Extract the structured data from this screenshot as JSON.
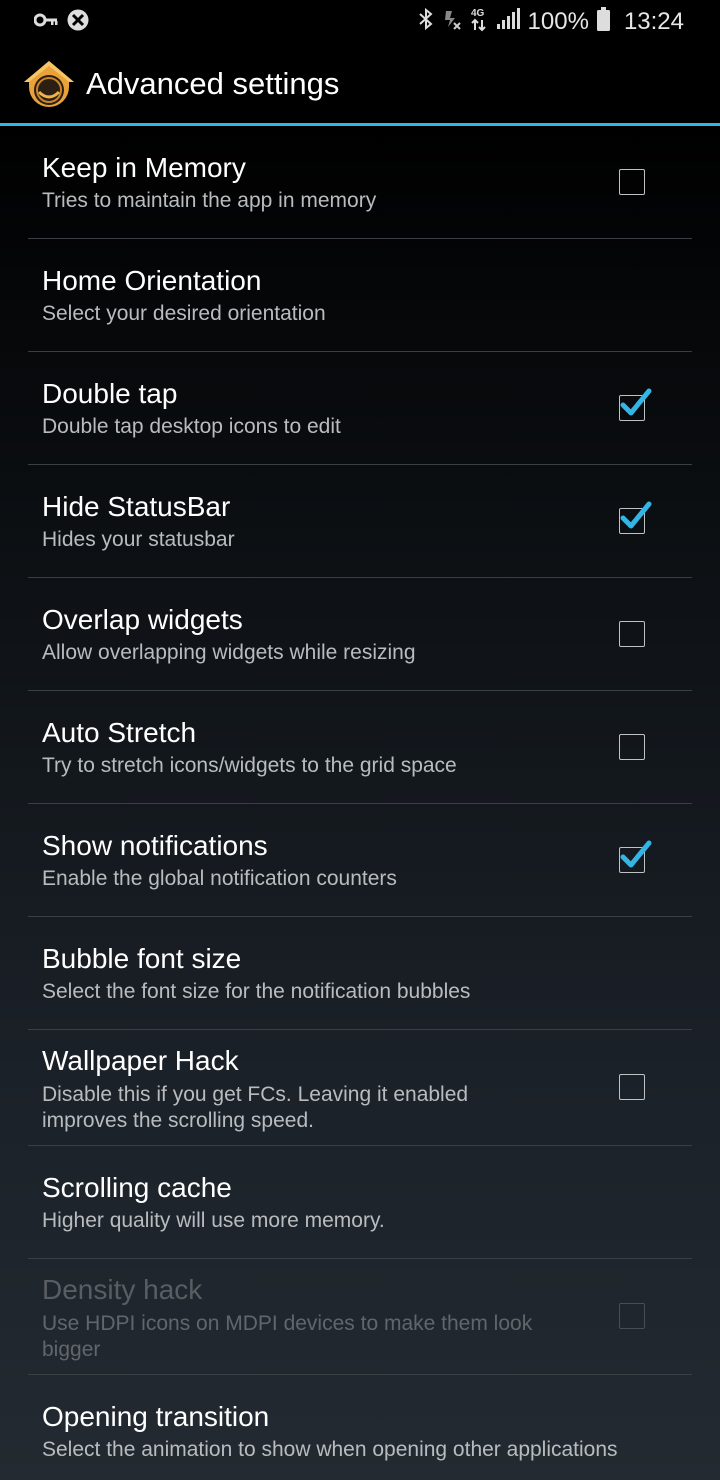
{
  "status_bar": {
    "left_icons": [
      "key-icon",
      "blocked-icon"
    ],
    "right_icons": [
      "bluetooth-icon",
      "mute-icon",
      "4g-icon",
      "signal-icon",
      "battery-icon"
    ],
    "battery": "100%",
    "time": "13:24"
  },
  "header": {
    "title": "Advanced settings",
    "icon": "home-app-icon"
  },
  "accent_color": "#33b5e5",
  "settings": [
    {
      "title": "Keep in Memory",
      "summary": "Tries to maintain the app in memory",
      "checkbox": true,
      "checked": false,
      "enabled": true
    },
    {
      "title": "Home Orientation",
      "summary": "Select your desired orientation",
      "checkbox": false,
      "enabled": true
    },
    {
      "title": "Double tap",
      "summary": "Double tap desktop icons to edit",
      "checkbox": true,
      "checked": true,
      "enabled": true
    },
    {
      "title": "Hide StatusBar",
      "summary": "Hides your statusbar",
      "checkbox": true,
      "checked": true,
      "enabled": true
    },
    {
      "title": "Overlap widgets",
      "summary": "Allow overlapping widgets while resizing",
      "checkbox": true,
      "checked": false,
      "enabled": true
    },
    {
      "title": "Auto Stretch",
      "summary": "Try to stretch icons/widgets to the grid space",
      "checkbox": true,
      "checked": false,
      "enabled": true
    },
    {
      "title": "Show notifications",
      "summary": "Enable the global notification counters",
      "checkbox": true,
      "checked": true,
      "enabled": true
    },
    {
      "title": "Bubble font size",
      "summary": "Select the font size for the notification bubbles",
      "checkbox": false,
      "enabled": true
    },
    {
      "title": "Wallpaper Hack",
      "summary": "Disable this if you get FCs. Leaving it enabled improves the scrolling speed.",
      "checkbox": true,
      "checked": false,
      "enabled": true
    },
    {
      "title": "Scrolling cache",
      "summary": "Higher quality will use more memory.",
      "checkbox": false,
      "enabled": true
    },
    {
      "title": "Density hack",
      "summary": "Use HDPI icons on MDPI devices to make them look bigger",
      "checkbox": true,
      "checked": false,
      "enabled": false
    },
    {
      "title": "Opening transition",
      "summary": "Select the animation to show when opening other applications",
      "checkbox": false,
      "enabled": true
    }
  ]
}
